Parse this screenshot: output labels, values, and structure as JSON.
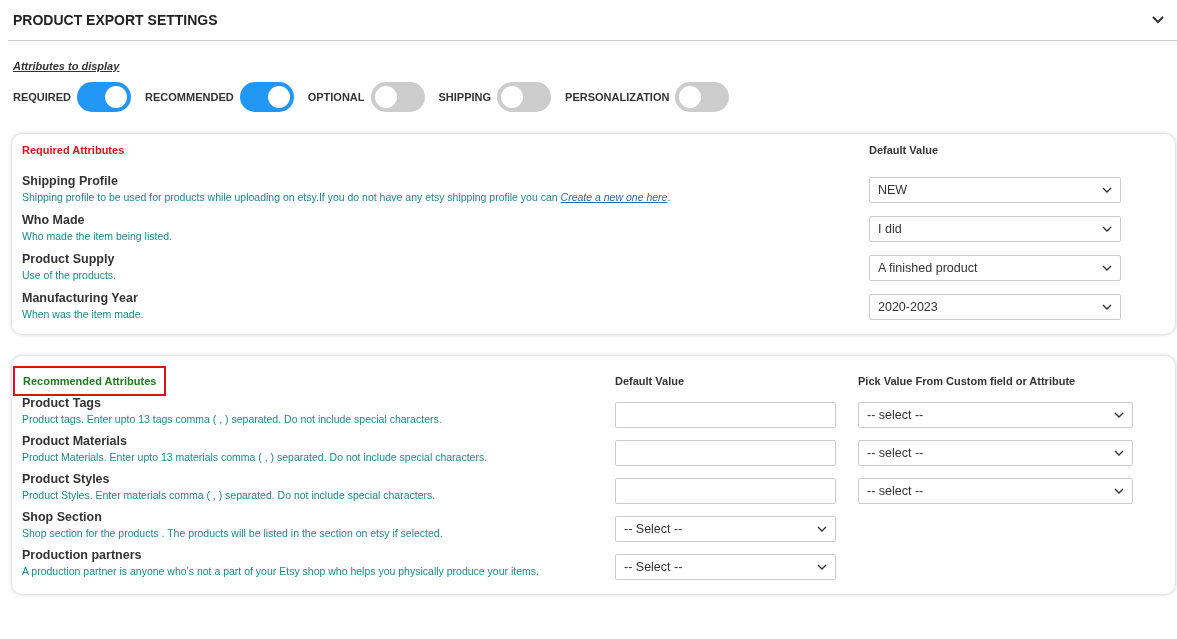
{
  "header": {
    "title": "PRODUCT EXPORT SETTINGS",
    "expanded": true
  },
  "attributes_to_display": {
    "label": "Attributes to display",
    "toggles": [
      {
        "label": "REQUIRED",
        "on": true
      },
      {
        "label": "RECOMMENDED",
        "on": true
      },
      {
        "label": "OPTIONAL",
        "on": false
      },
      {
        "label": "SHIPPING",
        "on": false
      },
      {
        "label": "PERSONALIZATION",
        "on": false
      }
    ]
  },
  "required_attributes": {
    "title": "Required Attributes",
    "default_header": "Default Value",
    "rows": [
      {
        "name": "Shipping Profile",
        "description": "Shipping profile to be used for products while uploading on etsy.If you do not have any etsy shipping profile you can ",
        "link": "Create a new one here",
        "suffix": ".",
        "default": "NEW"
      },
      {
        "name": "Who Made",
        "description": "Who made the item being listed.",
        "default": "I did"
      },
      {
        "name": "Product Supply",
        "description": "Use of the products.",
        "default": "A finished product"
      },
      {
        "name": "Manufacturing Year",
        "description": "When was the item made.",
        "default": "2020-2023"
      }
    ]
  },
  "recommended_attributes": {
    "title": "Recommended Attributes",
    "highlighted": true,
    "default_header": "Default Value",
    "pick_header": "Pick Value From Custom field or Attribute",
    "rows": [
      {
        "name": "Product Tags",
        "description": "Product tags. Enter upto 13 tags comma ( , ) separated. Do not include special characters.",
        "default": {
          "kind": "input"
        },
        "pick": "-- select --"
      },
      {
        "name": "Product Materials",
        "description": "Product Materials. Enter upto 13 materials comma ( , ) separated. Do not include special characters.",
        "default": {
          "kind": "input"
        },
        "pick": "-- select --"
      },
      {
        "name": "Product Styles",
        "description": "Product Styles. Enter materials comma ( , ) separated. Do not include special characters.",
        "default": {
          "kind": "input"
        },
        "pick": "-- select --"
      },
      {
        "name": "Shop Section",
        "description": "Shop section for the products . The products will be listed in the section on etsy if selected.",
        "default": {
          "kind": "select",
          "value": "-- Select --"
        }
      },
      {
        "name": "Production partners",
        "description": "A production partner is anyone who’s not a part of your Etsy shop who helps you physically produce your items.",
        "default": {
          "kind": "select",
          "value": "-- Select --"
        }
      }
    ]
  }
}
